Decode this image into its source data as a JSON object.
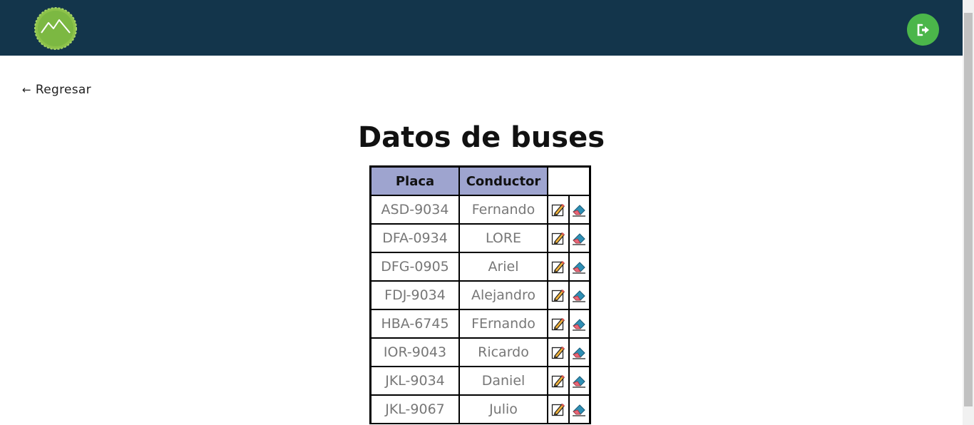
{
  "header": {
    "logo_icon": "mountain-logo-icon",
    "logout_icon": "logout-icon",
    "bar_color": "#13354b",
    "logout_color": "#4bb64a"
  },
  "nav": {
    "back_label": "Regresar",
    "back_icon": "arrow-left-icon"
  },
  "page": {
    "title": "Datos de buses"
  },
  "table": {
    "headers": {
      "placa": "Placa",
      "conductor": "Conductor"
    },
    "header_color": "#9ea4cf",
    "edit_icon": "pencil-edit-icon",
    "delete_icon": "eraser-delete-icon",
    "rows": [
      {
        "placa": "ASD-9034",
        "conductor": "Fernando"
      },
      {
        "placa": "DFA-0934",
        "conductor": "LORE"
      },
      {
        "placa": "DFG-0905",
        "conductor": "Ariel"
      },
      {
        "placa": "FDJ-9034",
        "conductor": "Alejandro"
      },
      {
        "placa": "HBA-6745",
        "conductor": "FErnando"
      },
      {
        "placa": "IOR-9043",
        "conductor": "Ricardo"
      },
      {
        "placa": "JKL-9034",
        "conductor": "Daniel"
      },
      {
        "placa": "JKL-9067",
        "conductor": "Julio"
      }
    ]
  }
}
